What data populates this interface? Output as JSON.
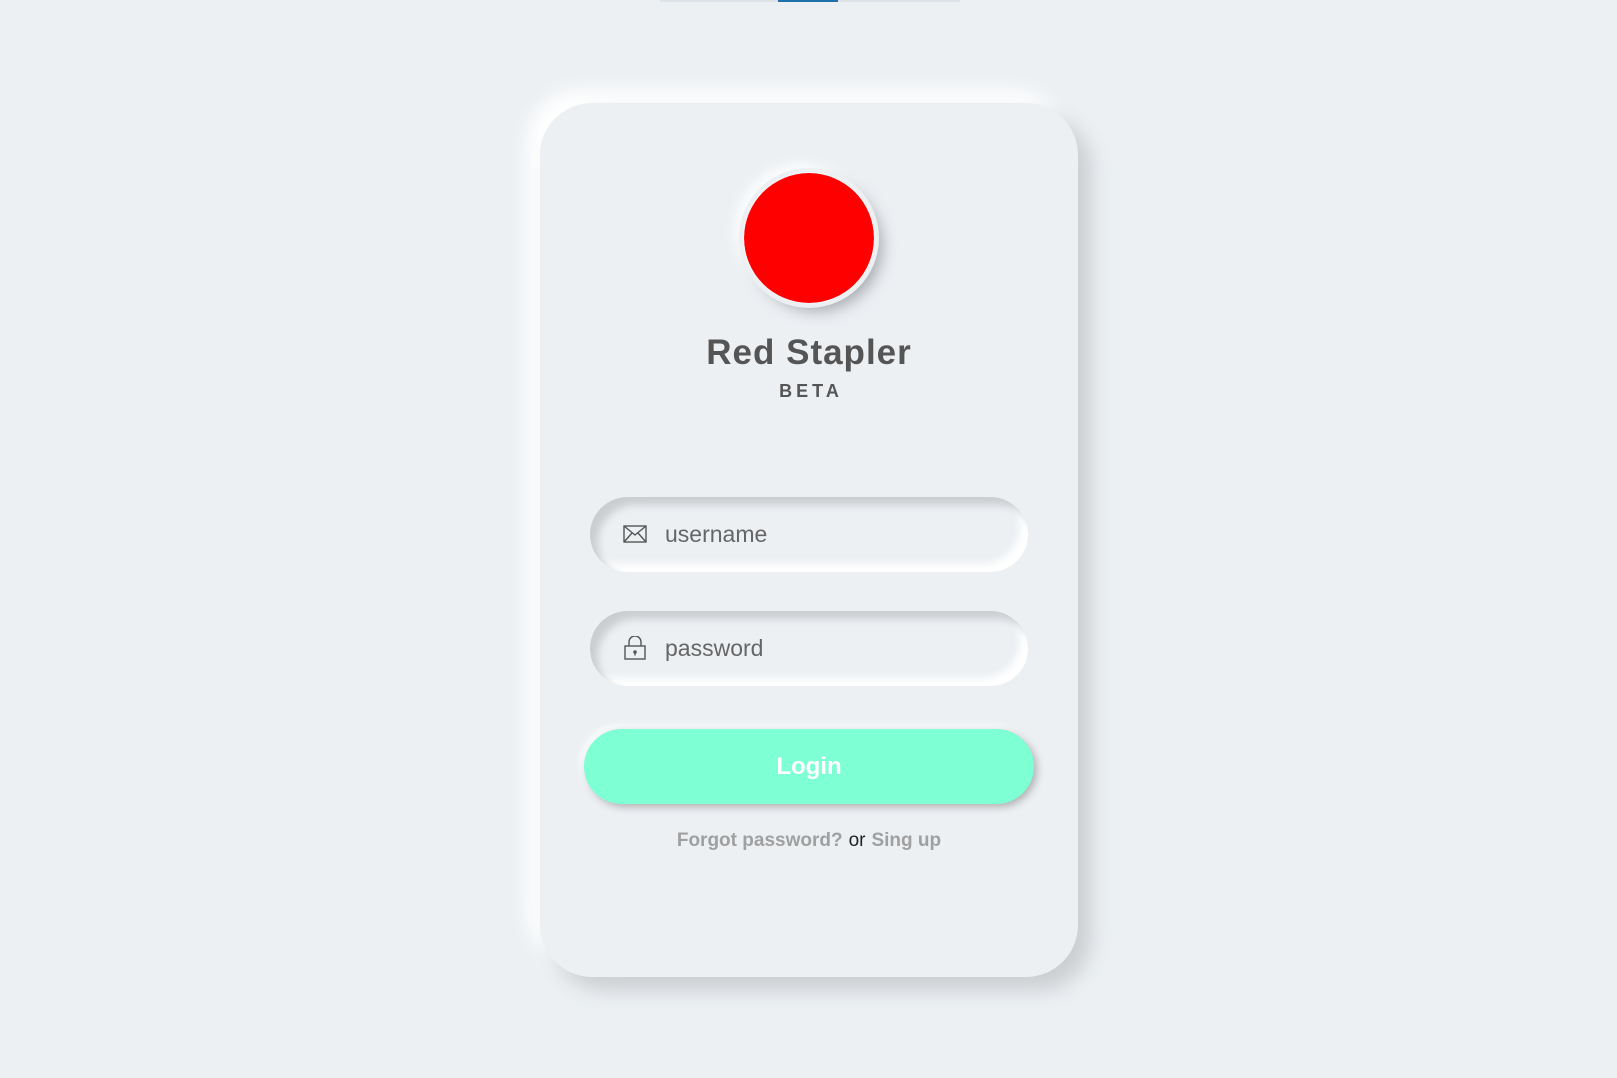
{
  "colors": {
    "background": "#ecf0f3",
    "logo": "#ff0000",
    "login_button": "#7fffd4",
    "heading_text": "#555555",
    "link_text": "#a0a0a0"
  },
  "brand": {
    "title": "Red Stapler",
    "subtitle": "BETA"
  },
  "form": {
    "username": {
      "placeholder": "username",
      "value": "",
      "icon": "envelope-icon"
    },
    "password": {
      "placeholder": "password",
      "value": "",
      "icon": "lock-icon"
    },
    "login_label": "Login"
  },
  "footer_links": {
    "forgot": "Forgot password?",
    "separator": "or",
    "signup": "Sing up"
  }
}
